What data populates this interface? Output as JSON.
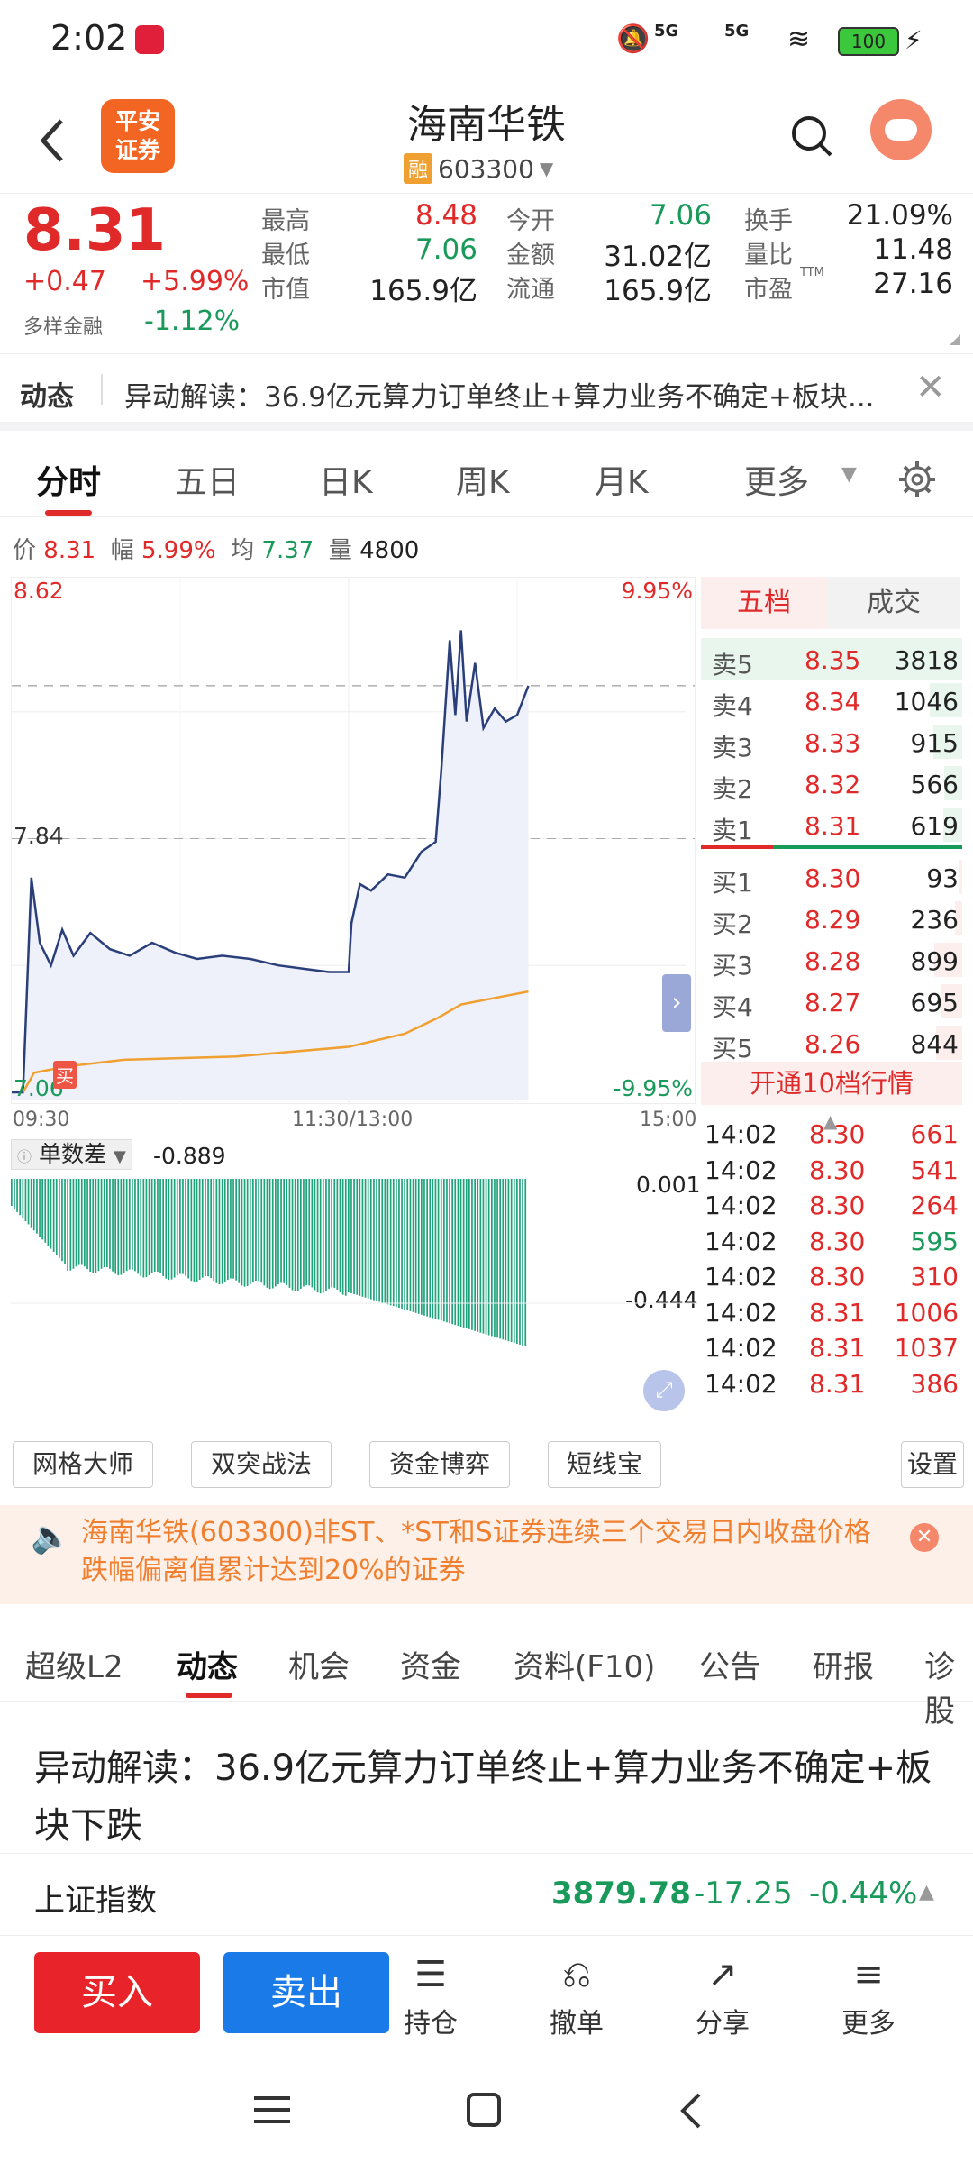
{
  "status": {
    "time": "2:02",
    "battery": "100",
    "net1": "5G",
    "net2": "5G"
  },
  "header": {
    "title": "海南华铁",
    "code": "603300",
    "rong_badge": "融",
    "logo_line1": "平安",
    "logo_line2": "证券"
  },
  "quote": {
    "price": "8.31",
    "change": "+0.47",
    "change_pct": "+5.99%",
    "diverse_label": "多样金融",
    "diverse_value": "-1.12%",
    "cells": [
      {
        "label": "最高",
        "value": "8.48",
        "color": "red"
      },
      {
        "label": "今开",
        "value": "7.06",
        "color": "green"
      },
      {
        "label": "换手",
        "value": "21.09%",
        "color": "dark"
      },
      {
        "label": "最低",
        "value": "7.06",
        "color": "green"
      },
      {
        "label": "金额",
        "value": "31.02亿",
        "color": "dark"
      },
      {
        "label": "量比",
        "value": "11.48",
        "color": "dark"
      },
      {
        "label": "市值",
        "value": "165.9亿",
        "color": "dark"
      },
      {
        "label": "流通",
        "value": "165.9亿",
        "color": "dark"
      },
      {
        "label": "市盈",
        "value": "27.16",
        "color": "dark",
        "sup": "TTM"
      }
    ]
  },
  "news": {
    "tag": "动态",
    "text": "异动解读：36.9亿元算力订单终止+算力业务不确定+板块..."
  },
  "tabs": [
    "分时",
    "五日",
    "日K",
    "周K",
    "月K",
    "更多"
  ],
  "info": {
    "price_label": "价",
    "price": "8.31",
    "range_label": "幅",
    "range": "5.99%",
    "avg_label": "均",
    "avg": "7.37",
    "vol_label": "量",
    "vol": "4800"
  },
  "chart_axes": {
    "top_price": "8.62",
    "mid_price": "7.84",
    "low_price": "7.06",
    "top_pct": "9.95%",
    "low_pct": "-9.95%",
    "t_start": "09:30",
    "t_mid": "11:30/13:00",
    "t_end": "15:00",
    "buy_marker": "买"
  },
  "orderbook": {
    "tabs": [
      "五档",
      "成交"
    ],
    "asks": [
      {
        "label": "卖5",
        "price": "8.35",
        "vol": "3818",
        "bar": 0.95
      },
      {
        "label": "卖4",
        "price": "8.34",
        "vol": "1046",
        "bar": 0.26
      },
      {
        "label": "卖3",
        "price": "8.33",
        "vol": "915",
        "bar": 0.23
      },
      {
        "label": "卖2",
        "price": "8.32",
        "vol": "566",
        "bar": 0.14
      },
      {
        "label": "卖1",
        "price": "8.31",
        "vol": "619",
        "bar": 0.15
      }
    ],
    "bids": [
      {
        "label": "买1",
        "price": "8.30",
        "vol": "93",
        "bar": 0.02
      },
      {
        "label": "买2",
        "price": "8.29",
        "vol": "236",
        "bar": 0.06
      },
      {
        "label": "买3",
        "price": "8.28",
        "vol": "899",
        "bar": 0.22
      },
      {
        "label": "买4",
        "price": "8.27",
        "vol": "695",
        "bar": 0.17
      },
      {
        "label": "买5",
        "price": "8.26",
        "vol": "844",
        "bar": 0.21
      }
    ],
    "open_level10": "开通10档行情"
  },
  "ticks": [
    {
      "time": "14:02",
      "price": "8.30",
      "vol": "661",
      "color": "red"
    },
    {
      "time": "14:02",
      "price": "8.30",
      "vol": "541",
      "color": "red"
    },
    {
      "time": "14:02",
      "price": "8.30",
      "vol": "264",
      "color": "red"
    },
    {
      "time": "14:02",
      "price": "8.30",
      "vol": "595",
      "color": "green"
    },
    {
      "time": "14:02",
      "price": "8.30",
      "vol": "310",
      "color": "red"
    },
    {
      "time": "14:02",
      "price": "8.31",
      "vol": "1006",
      "color": "red"
    },
    {
      "time": "14:02",
      "price": "8.31",
      "vol": "1037",
      "color": "red"
    },
    {
      "time": "14:02",
      "price": "8.31",
      "vol": "386",
      "color": "red"
    }
  ],
  "indicator": {
    "name": "单数差",
    "value": "-0.889",
    "top": "0.001",
    "mid": "-0.444"
  },
  "tools": [
    "网格大师",
    "双突战法",
    "资金博弈",
    "短线宝",
    "设置"
  ],
  "alert": {
    "text": "海南华铁(603300)非ST、*ST和S证券连续三个交易日内收盘价格跌幅偏离值累计达到20%的证券"
  },
  "sectabs": [
    "超级L2",
    "动态",
    "机会",
    "资金",
    "资料(F10)",
    "公告",
    "研报",
    "诊股"
  ],
  "article": {
    "title": "异动解读：36.9亿元算力订单终止+算力业务不确定+板块下跌"
  },
  "index": {
    "name": "上证指数",
    "value": "3879.78",
    "change": "-17.25",
    "pct": "-0.44%"
  },
  "actions": {
    "buy": "买入",
    "sell": "卖出",
    "items": [
      {
        "label": "持仓",
        "icon": "list-icon"
      },
      {
        "label": "撤单",
        "icon": "undo-icon"
      },
      {
        "label": "分享",
        "icon": "share-icon"
      },
      {
        "label": "更多",
        "icon": "menu-icon"
      }
    ]
  },
  "chart_data": {
    "type": "line",
    "x_range": [
      "09:30",
      "15:00"
    ],
    "ylim": [
      7.06,
      8.62
    ],
    "series": [],
    "price_points": [
      [
        0,
        7.06
      ],
      [
        3,
        7.06
      ],
      [
        4,
        7.06
      ],
      [
        7,
        7.72
      ],
      [
        10,
        7.52
      ],
      [
        14,
        7.45
      ],
      [
        18,
        7.56
      ],
      [
        22,
        7.48
      ],
      [
        28,
        7.55
      ],
      [
        35,
        7.5
      ],
      [
        42,
        7.48
      ],
      [
        50,
        7.52
      ],
      [
        58,
        7.49
      ],
      [
        66,
        7.47
      ],
      [
        75,
        7.48
      ],
      [
        85,
        7.47
      ],
      [
        95,
        7.45
      ],
      [
        104,
        7.44
      ],
      [
        113,
        7.43
      ],
      [
        120,
        7.43
      ],
      [
        121,
        7.58
      ],
      [
        124,
        7.7
      ],
      [
        128,
        7.68
      ],
      [
        134,
        7.73
      ],
      [
        140,
        7.72
      ],
      [
        146,
        7.8
      ],
      [
        151,
        7.83
      ],
      [
        153,
        8.05
      ],
      [
        156,
        8.45
      ],
      [
        158,
        8.22
      ],
      [
        160,
        8.48
      ],
      [
        162,
        8.2
      ],
      [
        165,
        8.38
      ],
      [
        168,
        8.18
      ],
      [
        172,
        8.24
      ],
      [
        176,
        8.2
      ],
      [
        180,
        8.22
      ],
      [
        184,
        8.31
      ]
    ],
    "avg_points": [
      [
        4,
        7.06
      ],
      [
        8,
        7.12
      ],
      [
        20,
        7.14
      ],
      [
        40,
        7.16
      ],
      [
        80,
        7.17
      ],
      [
        120,
        7.2
      ],
      [
        140,
        7.24
      ],
      [
        152,
        7.29
      ],
      [
        160,
        7.33
      ],
      [
        172,
        7.35
      ],
      [
        184,
        7.37
      ]
    ],
    "total_minutes": 240,
    "indicator_bars": 184
  }
}
